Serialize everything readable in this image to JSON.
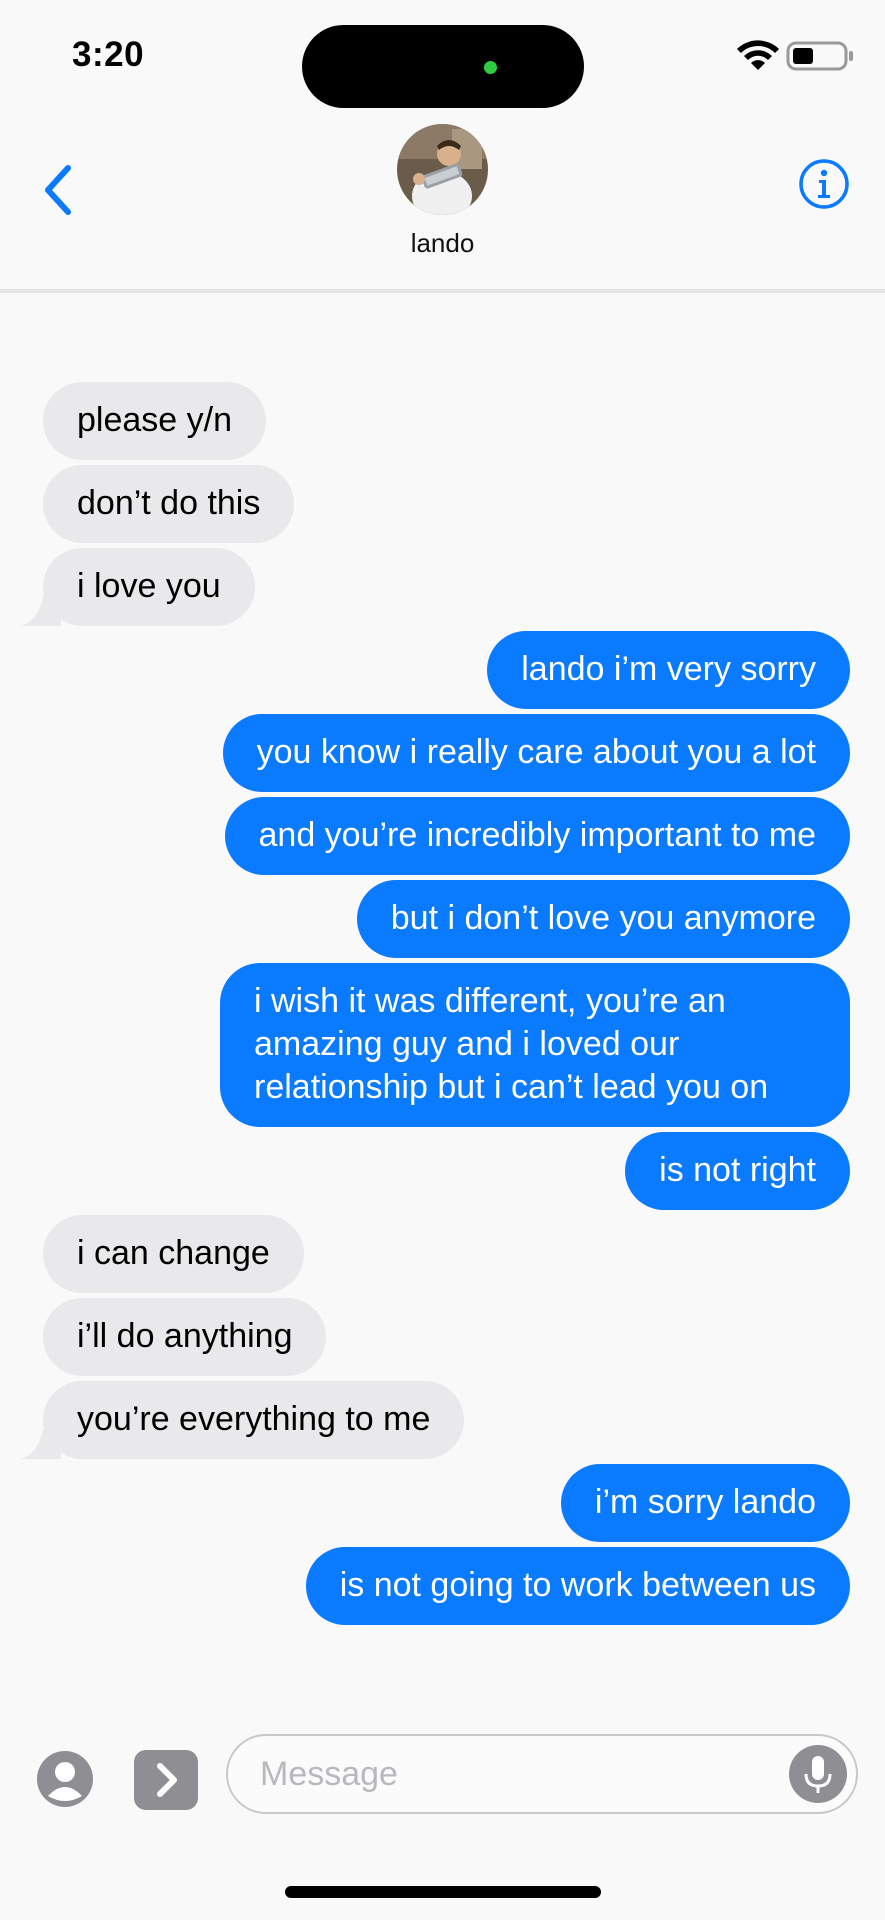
{
  "status_bar": {
    "time": "3:20",
    "icons": [
      "wifi-icon",
      "battery-icon"
    ]
  },
  "header": {
    "back_icon": "chevron-left-icon",
    "contact_name": "lando",
    "avatar": "contact-avatar",
    "info_icon": "info-icon"
  },
  "colors": {
    "accent": "#0a7aff",
    "incoming_bubble": "#e9e9eb",
    "background": "#f9f9fa"
  },
  "messages": [
    {
      "direction": "in",
      "text": "please y/n",
      "tail": false
    },
    {
      "direction": "in",
      "text": "don’t do this",
      "tail": false
    },
    {
      "direction": "in",
      "text": "i love you",
      "tail": true
    },
    {
      "direction": "out",
      "text": "lando i’m very sorry",
      "tail": false
    },
    {
      "direction": "out",
      "text": "you know i really care about you a lot",
      "tail": false
    },
    {
      "direction": "out",
      "text": "and you’re incredibly important to me",
      "tail": false
    },
    {
      "direction": "out",
      "text": "but i don’t love you anymore",
      "tail": false
    },
    {
      "direction": "out",
      "text": "i wish it was different, you’re an amazing guy and i loved our relationship but i can’t lead you on",
      "tail": false
    },
    {
      "direction": "out",
      "text": "is not right",
      "tail": false
    },
    {
      "direction": "in",
      "text": "i can change",
      "tail": false
    },
    {
      "direction": "in",
      "text": "i’ll do anything",
      "tail": false
    },
    {
      "direction": "in",
      "text": "you’re everything to me",
      "tail": true
    },
    {
      "direction": "out",
      "text": "i’m sorry lando",
      "tail": false
    },
    {
      "direction": "out",
      "text": "is not going to work between us",
      "tail": false
    }
  ],
  "input_bar": {
    "contact_icon": "contact-icon",
    "apps_icon": "chevron-right-icon",
    "placeholder": "Message",
    "mic_icon": "microphone-icon"
  }
}
